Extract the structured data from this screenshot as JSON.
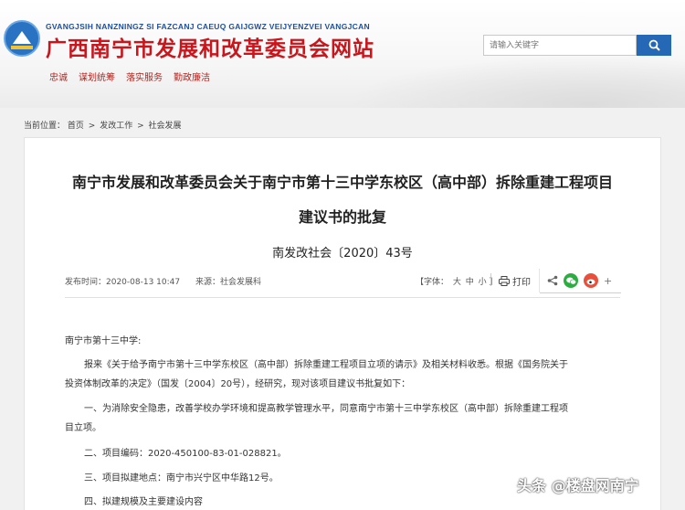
{
  "header": {
    "pinyin": "GVANGJSIH NANZNINGZ SI FAZCANJ CAEUQ GAIJGWZ VEIJYENZVEI VANGJCAN",
    "title": "广西南宁市发展和改革委员会网站",
    "nav": [
      "忠诚",
      "谋划统筹",
      "落实服务",
      "勤政廉洁"
    ],
    "search_placeholder": "请输入关键字"
  },
  "breadcrumb": {
    "label": "当前位置：",
    "items": [
      "首页",
      "发改工作",
      "社会发展"
    ],
    "separator": ">"
  },
  "article": {
    "title_line1": "南宁市发展和改革委员会关于南宁市第十三中学东校区（高中部）拆除重建工程项目",
    "title_line2": "建议书的批复",
    "doc_number": "南发改社会〔2020〕43号",
    "publish_time": "发布时间：2020-08-13 10:47",
    "source": "来源：社会发展科",
    "font_label": "【字体：",
    "font_large": "大",
    "font_medium": "中",
    "font_small": "小",
    "font_close": "】",
    "print_label": "打印",
    "paragraphs": [
      "南宁市第十三中学:",
      "报来《关于给予南宁市第十三中学东校区（高中部）拆除重建工程项目立项的请示》及相关材料收悉。根据《国务院关于",
      "投资体制改革的决定》（国发〔2004〕20号），经研究，现对该项目建议书批复如下：",
      "一、为消除安全隐患，改善学校办学环境和提高教学管理水平，同意南宁市第十三中学东校区（高中部）拆除重建工程项",
      "目立项。",
      "二、项目编码：2020-450100-83-01-028821。",
      "三、项目拟建地点：南宁市兴宁区中华路12号。",
      "四、拟建规模及主要建设内容"
    ]
  },
  "watermark": "头条 @楼盘网南宁",
  "colors": {
    "title_red": "#c8161d",
    "search_blue": "#2568b5",
    "wechat_green": "#2bad3f",
    "weibo_red": "#e8503b"
  }
}
